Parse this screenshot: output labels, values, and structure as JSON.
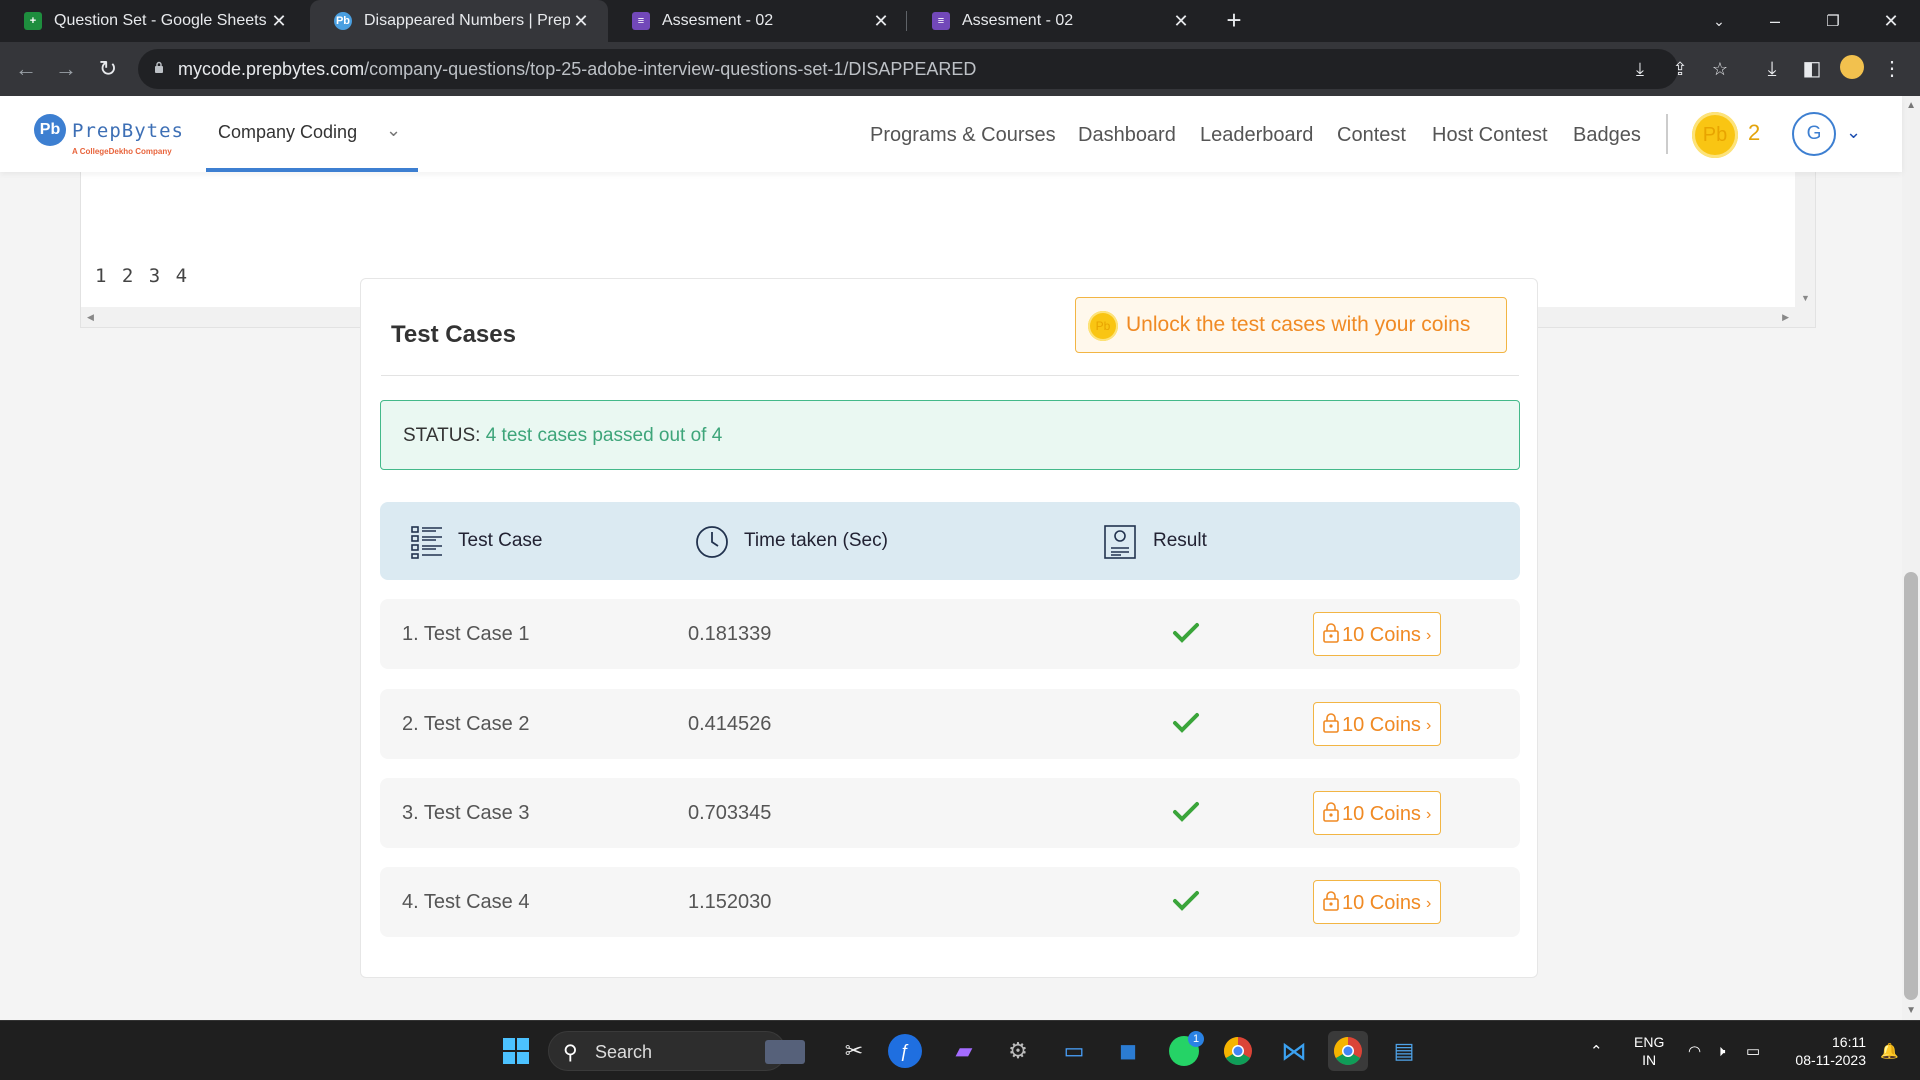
{
  "browser": {
    "tabs": [
      {
        "label": "Question Set - Google Sheets",
        "fav": "sheets-icon",
        "color": "#1e8e3e"
      },
      {
        "label": "Disappeared Numbers | PrepBytes",
        "fav": "prepbytes-icon",
        "color": "#4a9fe0"
      },
      {
        "label": "Assesment - 02",
        "fav": "forms-icon",
        "color": "#7248b9"
      },
      {
        "label": "Assesment - 02",
        "fav": "forms-icon",
        "color": "#7248b9"
      }
    ],
    "url_host": "mycode.prepbytes.com",
    "url_path": "/company-questions/top-25-adobe-interview-questions-set-1/DISAPPEARED"
  },
  "site": {
    "logo_text": "PrepBytes",
    "logo_sub": "A CollegeDekho Company",
    "logo_mark": "Pb",
    "company_coding": "Company Coding",
    "menu": [
      "Programs & Courses",
      "Dashboard",
      "Leaderboard",
      "Contest",
      "Host Contest",
      "Badges"
    ],
    "coin_mark": "Pb",
    "coin_count": "2",
    "avatar_initial": "G"
  },
  "code_output": "1 2 3 4",
  "test_cases": {
    "title": "Test Cases",
    "unlock_label": "Unlock the test cases with your coins",
    "status_label": "STATUS: ",
    "status_value": "4 test cases passed out of 4",
    "headers": {
      "name": "Test Case",
      "time": "Time taken (Sec)",
      "result": "Result"
    },
    "rows": [
      {
        "name": "1. Test Case 1",
        "time": "0.181339",
        "coins": "10 Coins"
      },
      {
        "name": "2. Test Case 2",
        "time": "0.414526",
        "coins": "10 Coins"
      },
      {
        "name": "3. Test Case 3",
        "time": "0.703345",
        "coins": "10 Coins"
      },
      {
        "name": "4. Test Case 4",
        "time": "1.152030",
        "coins": "10 Coins"
      }
    ]
  },
  "taskbar": {
    "search_label": "Search",
    "lang_top": "ENG",
    "lang_bottom": "IN",
    "time": "16:11",
    "date": "08-11-2023",
    "whatsapp_badge": "1"
  },
  "colors": {
    "accent": "#3d7fd1",
    "coin": "#f9c513",
    "status_green": "#3ea57a",
    "orange": "#f08a24"
  }
}
